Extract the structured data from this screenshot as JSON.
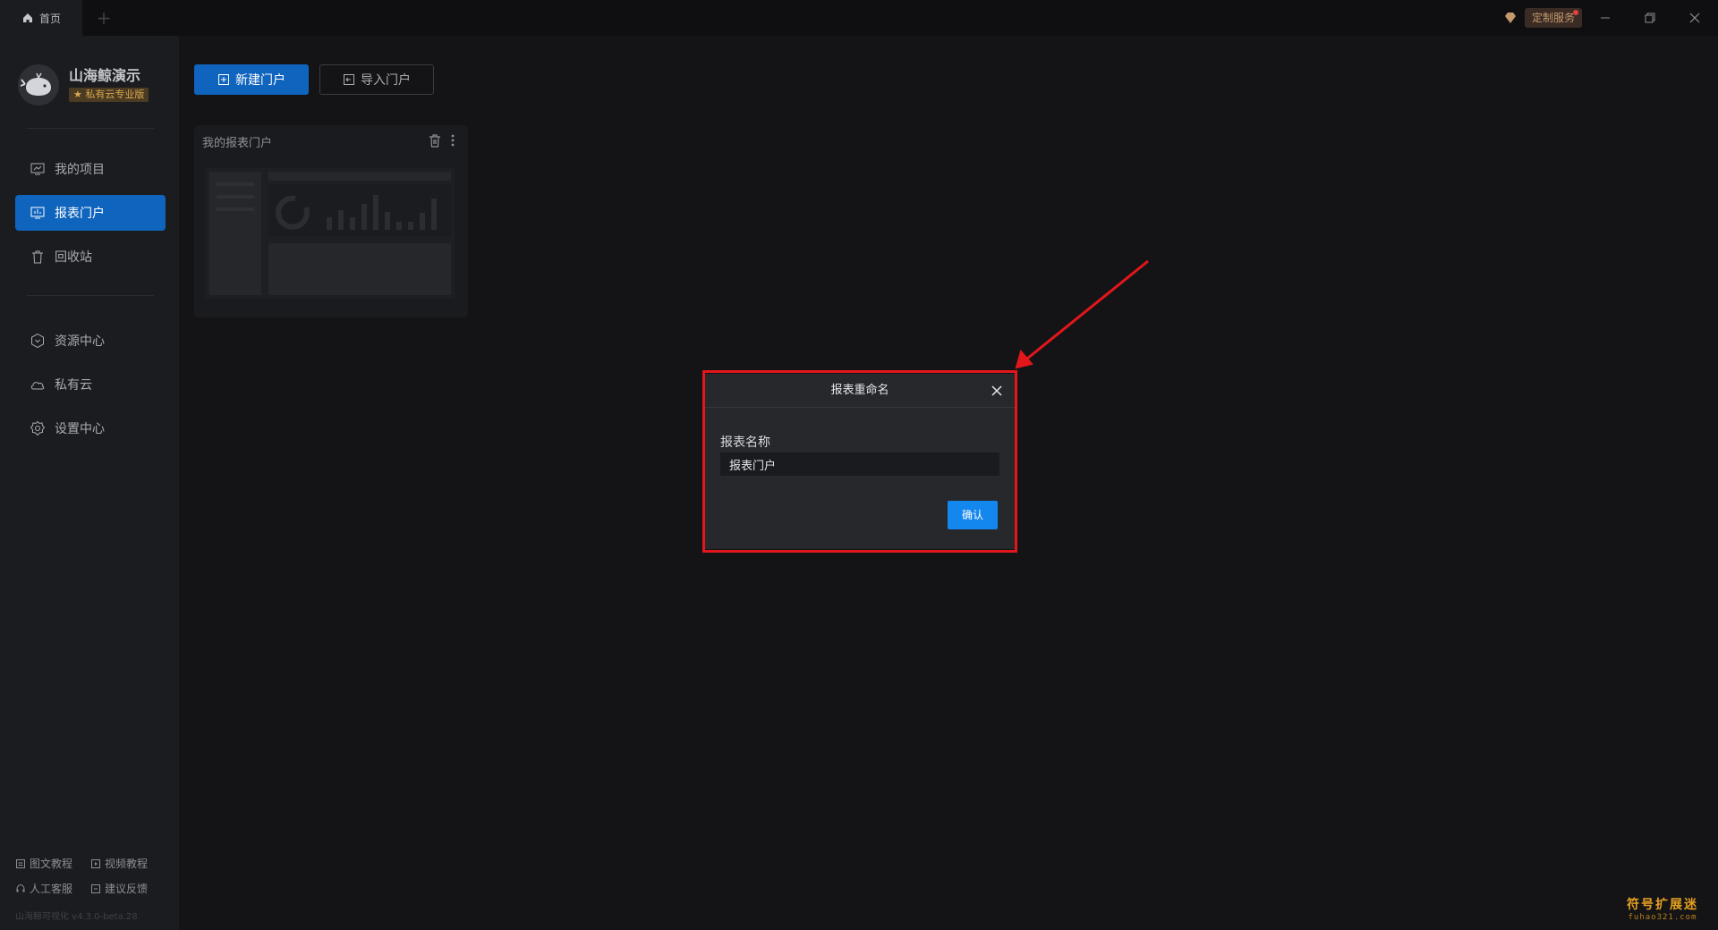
{
  "titlebar": {
    "tab_label": "首页",
    "service_label": "定制服务"
  },
  "sidebar": {
    "user_name": "山海鲸演示",
    "user_badge": "★ 私有云专业版",
    "nav_items": [
      {
        "label": "我的项目",
        "icon": "chart-board-icon",
        "active": false
      },
      {
        "label": "报表门户",
        "icon": "monitor-report-icon",
        "active": true
      },
      {
        "label": "回收站",
        "icon": "trash-icon",
        "active": false
      },
      {
        "label": "资源中心",
        "icon": "hexagon-resource-icon",
        "active": false
      },
      {
        "label": "私有云",
        "icon": "cloud-icon",
        "active": false
      },
      {
        "label": "设置中心",
        "icon": "gear-icon",
        "active": false
      }
    ],
    "help_links": {
      "text_tutorial": "图文教程",
      "video_tutorial": "视频教程",
      "support": "人工客服",
      "feedback": "建议反馈"
    },
    "version": "山海鲸可视化 v4.3.0-beta.28"
  },
  "toolbar": {
    "new_label": "新建门户",
    "import_label": "导入门户"
  },
  "card": {
    "title": "我的报表门户"
  },
  "dialog": {
    "title": "报表重命名",
    "field_label": "报表名称",
    "field_value": "报表门户",
    "confirm_label": "确认"
  },
  "watermark": {
    "main": "符号扩展迷",
    "sub": "fuhao321.com"
  },
  "colors": {
    "accent": "#0f64bd",
    "confirm": "#1487ee",
    "highlight": "#e3161b",
    "badge": "#d9a650"
  }
}
